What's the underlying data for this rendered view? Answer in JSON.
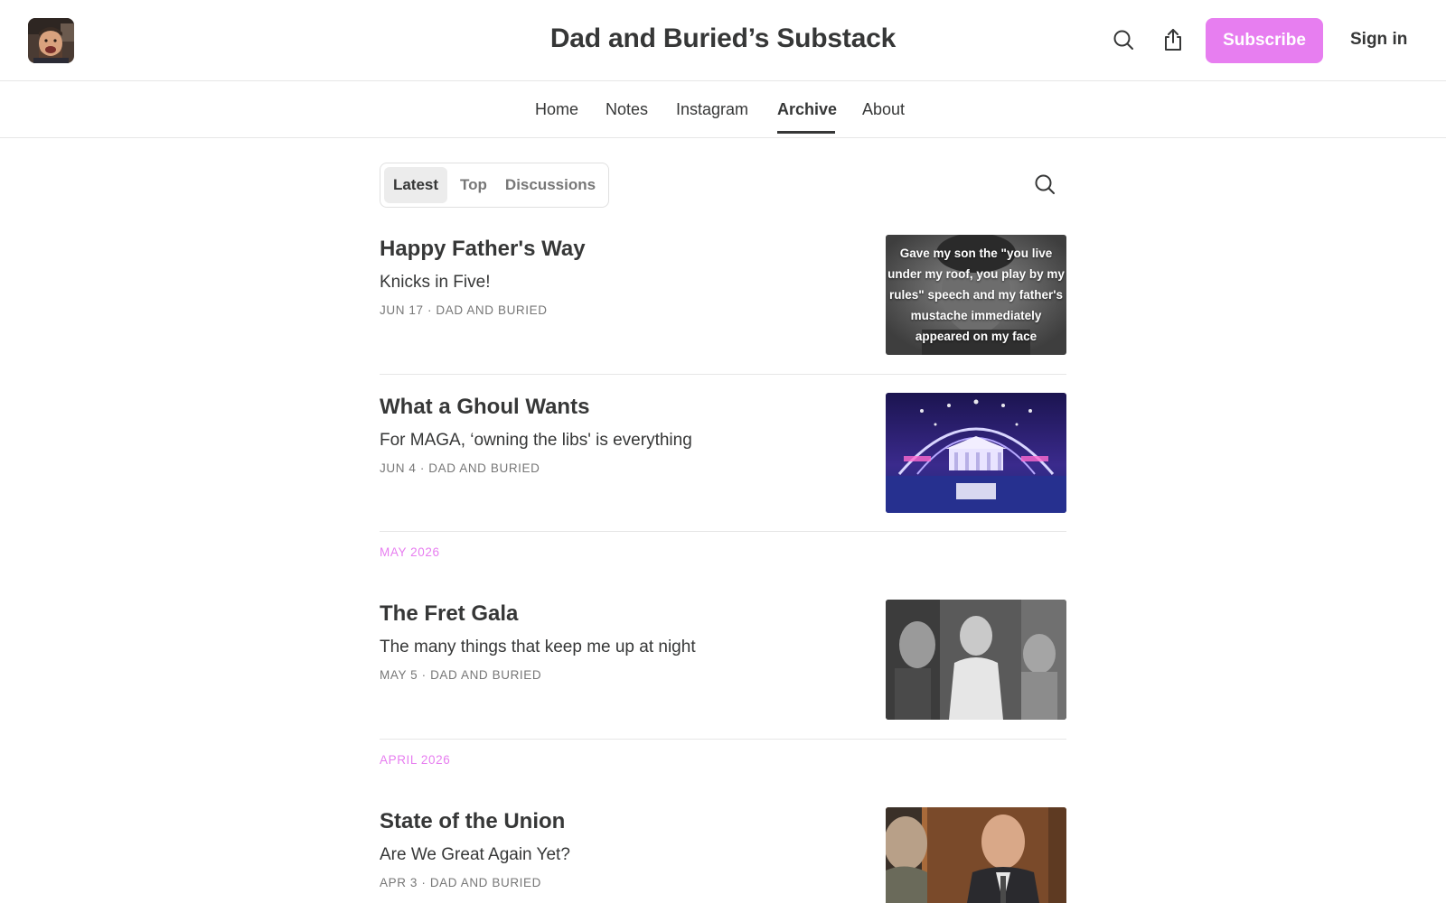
{
  "header": {
    "site_title": "Dad and Buried’s Substack",
    "subscribe_label": "Subscribe",
    "sign_in_label": "Sign in",
    "icons": [
      "search-icon",
      "share-icon"
    ],
    "accent_color": "#e77ef0"
  },
  "nav": {
    "items": [
      {
        "label": "Home"
      },
      {
        "label": "Notes"
      },
      {
        "label": "Instagram"
      },
      {
        "label": "Archive",
        "active": true
      },
      {
        "label": "About"
      }
    ]
  },
  "filters": {
    "tabs": [
      {
        "label": "Latest",
        "active": true
      },
      {
        "label": "Top"
      },
      {
        "label": "Discussions"
      }
    ]
  },
  "posts": [
    {
      "title": "Happy Father's Way",
      "subtitle": "Knicks in Five!",
      "meta": "JUN 17 · DAD AND BURIED",
      "thumb_text": "Gave my son the \"you live under my roof, you play by my rules\" speech and my father's mustache immediately appeared on my face"
    },
    {
      "title": "What a Ghoul Wants",
      "subtitle": "For MAGA, ‘owning the libs' is everything",
      "meta": "JUN 4 · DAD AND BURIED"
    },
    {
      "title": "The Fret Gala",
      "subtitle": "The many things that keep me up at night",
      "meta": "MAY 5 · DAD AND BURIED"
    },
    {
      "title": "State of the Union",
      "subtitle": "Are We Great Again Yet?",
      "meta": "APR 3 · DAD AND BURIED"
    }
  ],
  "months": [
    "MAY 2026",
    "APRIL 2026"
  ]
}
